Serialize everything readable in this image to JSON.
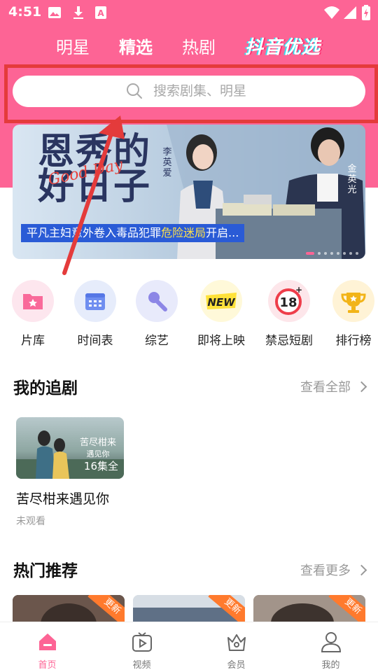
{
  "status_bar": {
    "time": "4:51",
    "left_icons": [
      "image-icon",
      "download-icon",
      "font-app-icon"
    ],
    "right_icons": [
      "wifi-icon",
      "signal-icon",
      "battery-icon"
    ]
  },
  "top_tabs": [
    {
      "label": "明星",
      "active": false
    },
    {
      "label": "精选",
      "active": true
    },
    {
      "label": "热剧",
      "active": false
    },
    {
      "label": "抖音优选",
      "active": false
    }
  ],
  "search": {
    "placeholder": "搜索剧集、明星"
  },
  "banner": {
    "title_line1": "恩秀的",
    "title_line2": "好日子",
    "title_en": "Good Day",
    "actor_a": "李英爱",
    "actor_b": "金英光",
    "caption_prefix": "平凡主妇意外卷入毒品犯罪",
    "caption_highlight": "危险迷局",
    "caption_suffix": "开启..."
  },
  "categories": [
    {
      "label": "片库",
      "icon": "folder-star-icon"
    },
    {
      "label": "时间表",
      "icon": "calendar-icon"
    },
    {
      "label": "综艺",
      "icon": "microphone-icon"
    },
    {
      "label": "即将上映",
      "icon": "new-badge-icon"
    },
    {
      "label": "禁忌短剧",
      "icon": "age-18-icon"
    },
    {
      "label": "排行榜",
      "icon": "trophy-icon"
    }
  ],
  "my_shows": {
    "title": "我的追剧",
    "more": "查看全部",
    "items": [
      {
        "title": "苦尽柑来遇见你",
        "poster_text": "苦尽柑来遇见你",
        "episodes": "16集全",
        "status": "未观看"
      }
    ]
  },
  "hot": {
    "title": "热门推荐",
    "more": "查看更多",
    "badge": "更新"
  },
  "bottom_nav": [
    {
      "label": "首页",
      "icon": "home-icon",
      "active": true
    },
    {
      "label": "视频",
      "icon": "tv-play-icon",
      "active": false
    },
    {
      "label": "会员",
      "icon": "crown-icon",
      "active": false
    },
    {
      "label": "我的",
      "icon": "user-icon",
      "active": false
    }
  ],
  "colors": {
    "brand_pink": "#fd6495",
    "annotation_red": "#e43b3b"
  }
}
